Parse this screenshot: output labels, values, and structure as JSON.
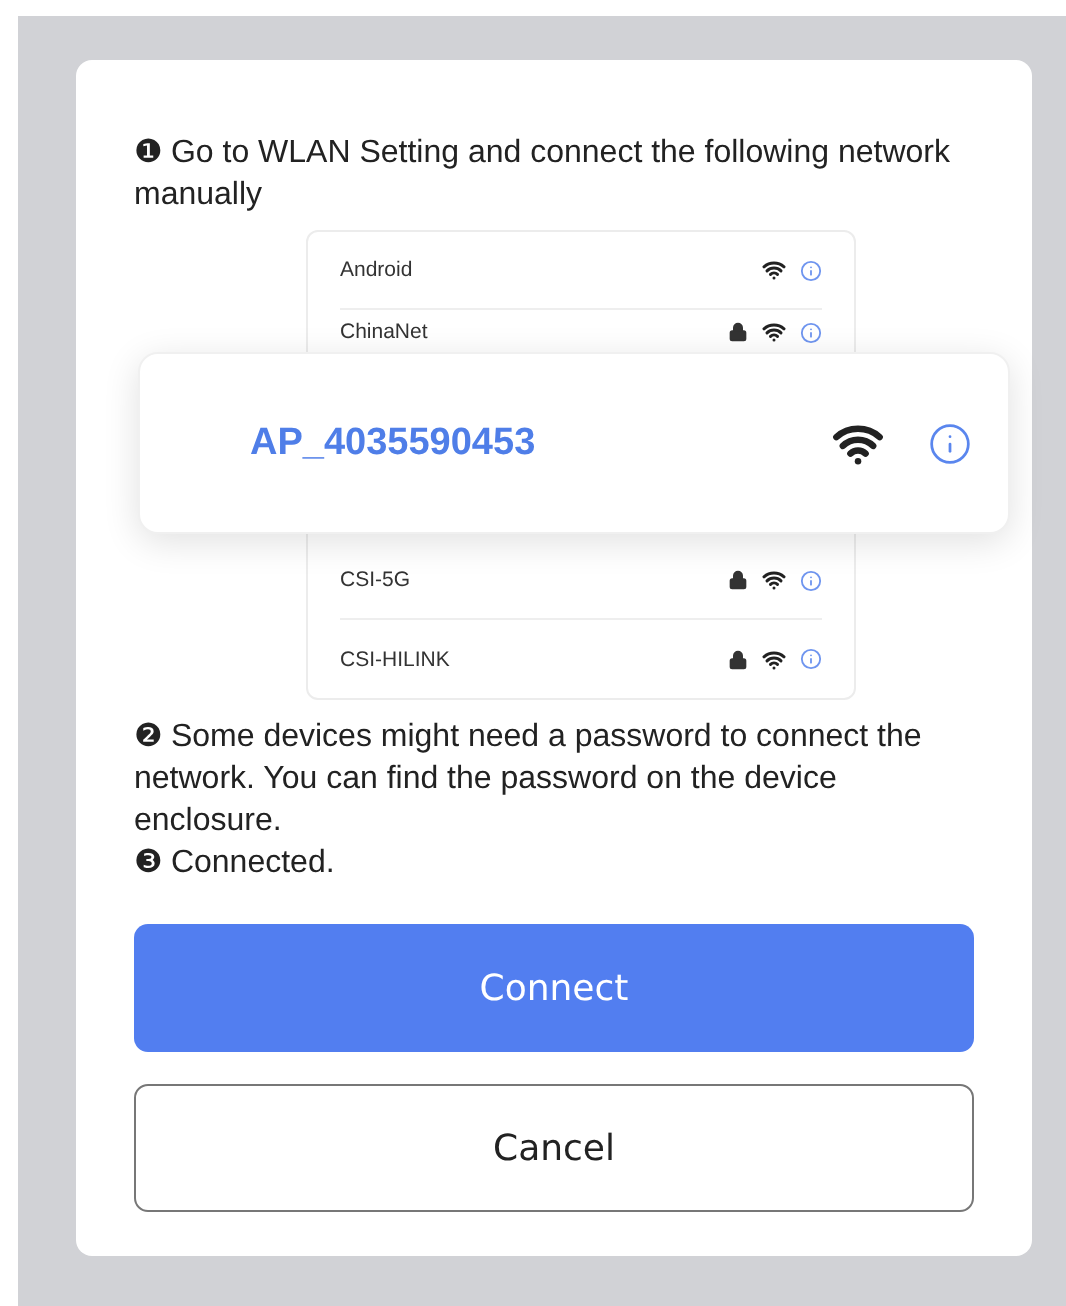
{
  "steps_top": [
    {
      "mark": "❶",
      "text": "Go to WLAN Setting and connect the following network manually"
    }
  ],
  "networks_above": [
    {
      "name": "Android",
      "locked": false
    },
    {
      "name": "ChinaNet",
      "locked": true
    }
  ],
  "highlighted_network": {
    "name": "AP_4035590453"
  },
  "networks_below": [
    {
      "name": "CSI-5G",
      "locked": true
    },
    {
      "name": "CSI-HILINK",
      "locked": true
    }
  ],
  "steps_bottom": [
    {
      "mark": "❷",
      "text": "Some devices might need a password to connect the network. You can find the password on the device enclosure."
    },
    {
      "mark": "❸",
      "text": "Connected."
    }
  ],
  "buttons": [
    {
      "label": "Connect",
      "kind": "primary"
    },
    {
      "label": "Cancel",
      "kind": "secondary"
    }
  ]
}
